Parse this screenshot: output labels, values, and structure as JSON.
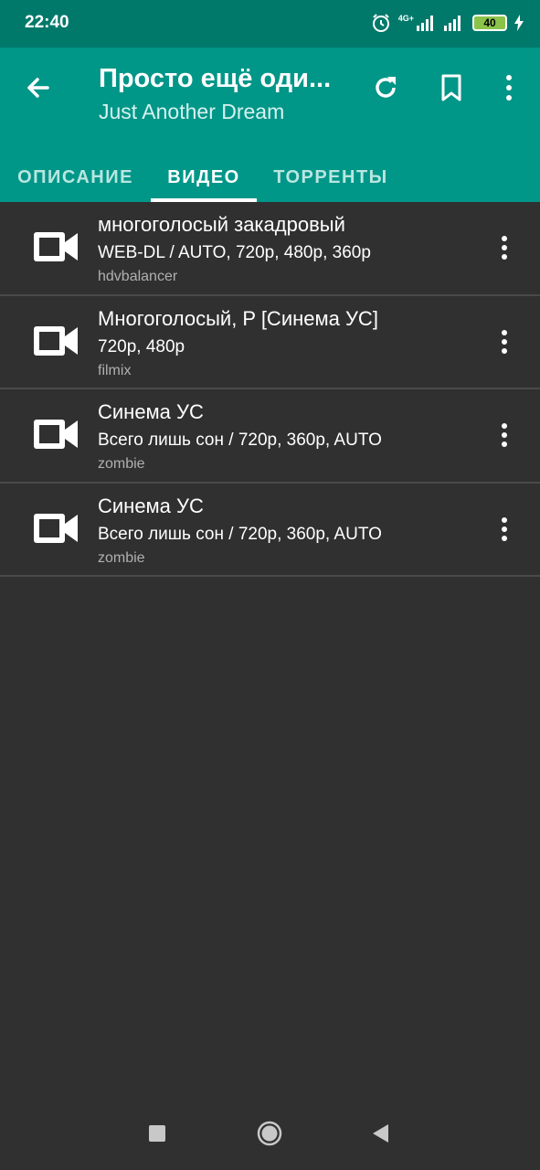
{
  "status": {
    "time": "22:40",
    "network": "4G+",
    "battery": "40"
  },
  "header": {
    "title": "Просто ещё оди...",
    "subtitle": "Just Another Dream"
  },
  "tabs": [
    {
      "label": "ОПИСАНИЕ"
    },
    {
      "label": "ВИДЕО"
    },
    {
      "label": "ТОРРЕНТЫ"
    }
  ],
  "videos": [
    {
      "title": "многоголосый закадровый",
      "quality": "WEB-DL / AUTO, 720p, 480p, 360p",
      "source": "hdvbalancer"
    },
    {
      "title": "Многоголосый, P [Синема УС]",
      "quality": "720p, 480p",
      "source": "filmix"
    },
    {
      "title": "Синема УС",
      "quality": "Всего лишь сон / 720p, 360p, AUTO",
      "source": "zombie"
    },
    {
      "title": "Синема УС",
      "quality": "Всего лишь сон / 720p, 360p, AUTO",
      "source": "zombie"
    }
  ],
  "colors": {
    "appbar": "#009688",
    "statusbar": "#00796b",
    "background": "#303030"
  }
}
